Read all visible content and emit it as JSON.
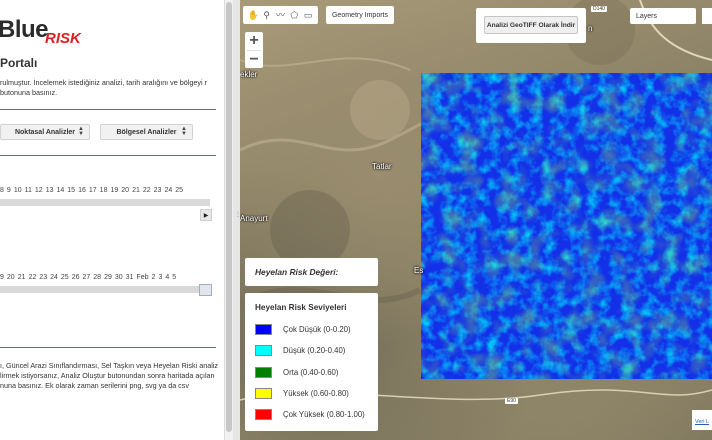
{
  "sidebar": {
    "logo_text": "Blue",
    "logo_accent": "RISK",
    "portal_title": "Portalı",
    "intro_text": "rulmuştur. İncelemek istediğiniz analizi, tarih aralığını ve bölgeyi r butonuna basınız.",
    "point_analysis_select": "Noktasal Analizler",
    "regional_analysis_select": "Bölgesel Analizler",
    "slider1_ticks": [
      "8",
      "9",
      "10",
      "11",
      "12",
      "13",
      "14",
      "15",
      "16",
      "17",
      "18",
      "19",
      "20",
      "21",
      "22",
      "23",
      "24",
      "25"
    ],
    "slider2_ticks": [
      "9",
      "20",
      "21",
      "22",
      "23",
      "24",
      "25",
      "26",
      "27",
      "28",
      "29",
      "30",
      "31",
      "Feb",
      "2",
      "3",
      "4",
      "5"
    ],
    "description": "ı, Güncel Arazi Sınıflandırması, Sel Taşkın veya Heyelan Riski analiz lirmek istiyorsanız, Analiz Oluştur butonundan sonra haritada açılan nuna basınız. Ek olarak zaman serilerini png, svg ya da csv",
    "accent_color": "#e53935"
  },
  "map": {
    "toolbar_icons": [
      "hand-icon",
      "marker-icon",
      "polyline-icon",
      "polygon-icon",
      "rectangle-icon"
    ],
    "geometry_imports_label": "Geometry Imports",
    "download_geotiff_label": "Analizi GeoTIFF Olarak İndir",
    "layers_label": "Layers",
    "zoom_in_label": "+",
    "zoom_out_label": "−",
    "places": {
      "tatlar": "Tatlar",
      "anayurt": "Anayurt",
      "ekler": "ekler",
      "es": "Es",
      "n": "n"
    },
    "road_d140": "D140",
    "road_e90": "E90",
    "data_link": "Veri L"
  },
  "legend": {
    "value_title": "Heyelan Risk Değeri:",
    "heading": "Heyelan Risk Seviyeleri",
    "items": [
      {
        "label": "Çok Düşük (0-0.20)",
        "color": "#0000ff"
      },
      {
        "label": "Düşük (0.20-0.40)",
        "color": "#00ffff"
      },
      {
        "label": "Orta (0.40-0.60)",
        "color": "#008000"
      },
      {
        "label": "Yüksek (0.60-0.80)",
        "color": "#ffff00"
      },
      {
        "label": "Çok Yüksek (0.80-1.00)",
        "color": "#ff0000"
      }
    ]
  }
}
